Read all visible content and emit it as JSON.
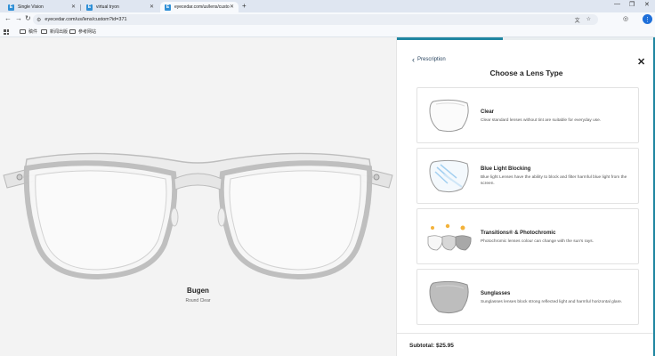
{
  "browser": {
    "tabs": [
      {
        "label": "Single Vision",
        "favicon": "E",
        "active": false
      },
      {
        "label": "virtual tryon",
        "favicon": "E",
        "active": false
      },
      {
        "label": "eyecedar.com/us/lens/custo",
        "favicon": "E",
        "active": true
      }
    ],
    "url": "eyecedar.com/us/lens/custom?id=371",
    "bookmarks": [
      "稿件",
      "新闻出版",
      "参考网站"
    ],
    "profile_initial": "⋮"
  },
  "product": {
    "name": "Bugen",
    "variant": "Round Clear"
  },
  "panel": {
    "back_label": "Prescription",
    "title": "Choose a Lens Type",
    "progress_fraction": 0.41,
    "accent_color": "#1f86a1",
    "options": [
      {
        "title": "Clear",
        "description": "Clear standard lenses without tint are suitable for everyday use.",
        "icon": "clear-lens-icon"
      },
      {
        "title": "Blue Light Blocking",
        "description": "Blue light Lenses have the ability to block and filter harmful blue light from the screen.",
        "icon": "blue-light-lens-icon"
      },
      {
        "title": "Transitions® & Photochromic",
        "description": "Photochromic lenses colour can change with the sun's rays.",
        "icon": "photochromic-lens-icon"
      },
      {
        "title": "Sunglasses",
        "description": "Sunglasses lenses block strong reflected light and harmful horizontal glare.",
        "icon": "sunglasses-lens-icon"
      }
    ],
    "subtotal": "Subtotal: $25.95"
  }
}
